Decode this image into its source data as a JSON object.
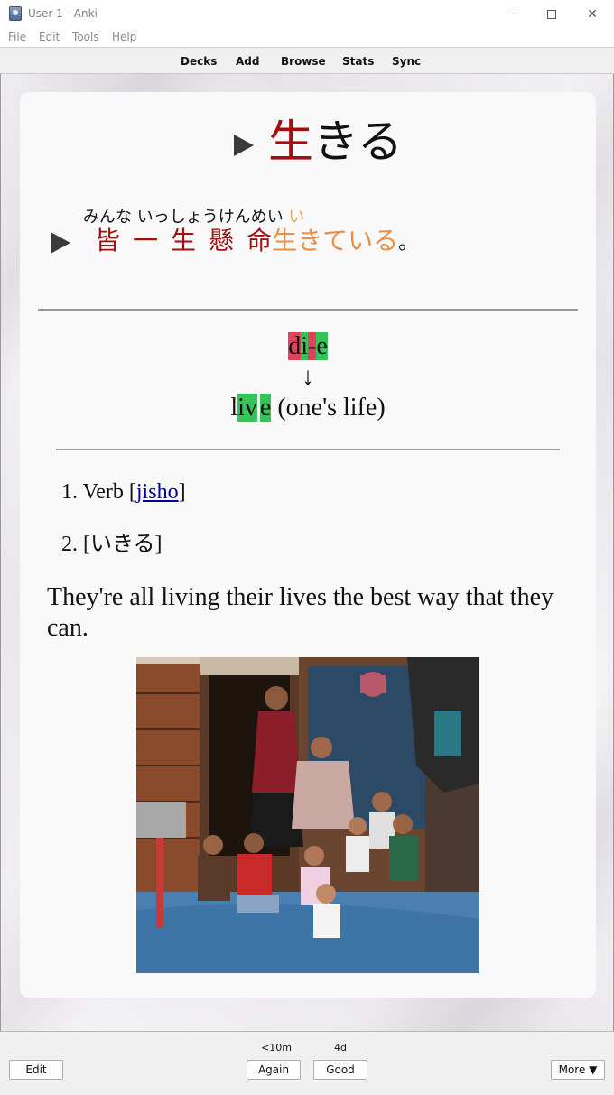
{
  "window": {
    "title": "User 1 - Anki"
  },
  "menu": [
    "File",
    "Edit",
    "Tools",
    "Help"
  ],
  "toolbar": [
    "Decks",
    "Add",
    "Browse",
    "Stats",
    "Sync"
  ],
  "card": {
    "word_kanji": "生",
    "word_kana": "きる",
    "reading_main": "みんな いっしょうけんめい ",
    "reading_hl": "い",
    "sentence_kanji": [
      "皆",
      "一",
      "生",
      "懸",
      "命"
    ],
    "sentence_orange": "生きている",
    "sentence_end": "。",
    "diagram": {
      "top_r1": "d",
      "top_g1": "i",
      "top_r2": "-",
      "top_g2": "e",
      "arrow": "↓",
      "bottom_plain1": "l",
      "bottom_g1": "iv",
      "bottom_plain2": "",
      "bottom_g2": "e",
      "bottom_rest": " (one's life)"
    },
    "definitions": [
      {
        "num": "1.",
        "text": "Verb [",
        "link": "jisho",
        "end": "]"
      },
      {
        "num": "2.",
        "text": "[いきる]"
      }
    ],
    "english": "They're all living their lives the best way that they can."
  },
  "bottom": {
    "edit": "Edit",
    "again": "Again",
    "again_due": "<10m",
    "good": "Good",
    "good_due": "4d",
    "more": "More ▼"
  },
  "colors": {
    "kanji": "#a01010",
    "orange": "#e8904a",
    "red_hl": "#e0445c",
    "green_hl": "#38c25a"
  }
}
